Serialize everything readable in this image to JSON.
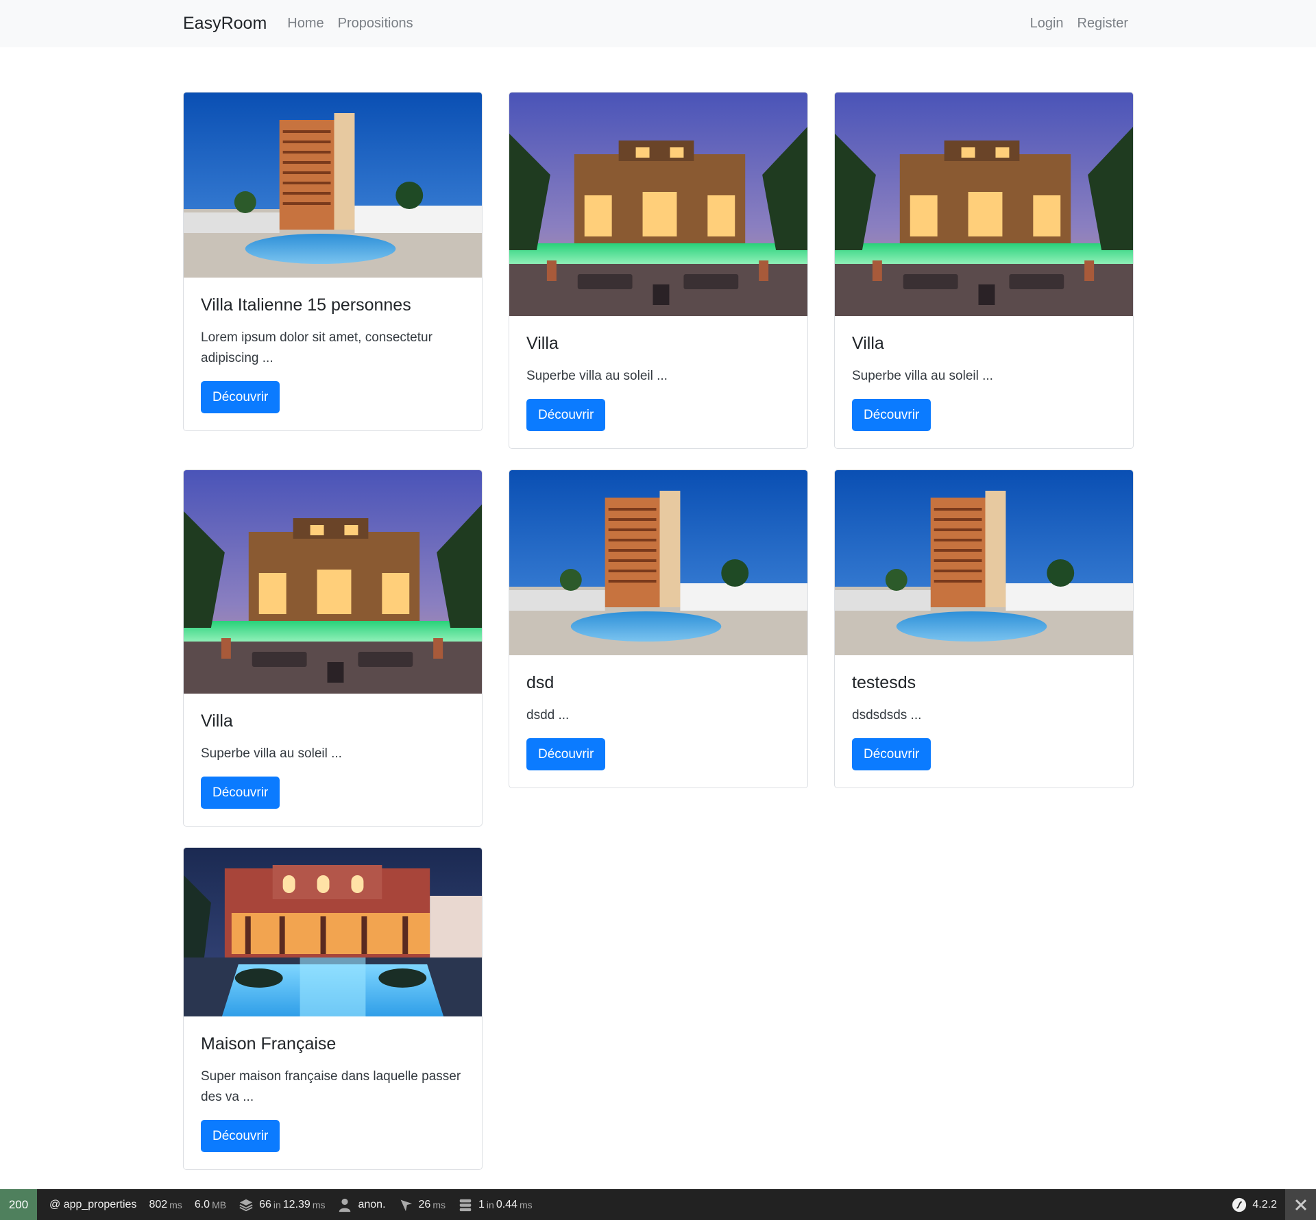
{
  "navbar": {
    "brand": "EasyRoom",
    "links": [
      "Home",
      "Propositions"
    ],
    "right_links": [
      "Login",
      "Register"
    ]
  },
  "cards": [
    {
      "title": "Villa Italienne 15 personnes",
      "text": "Lorem ipsum dolor sit amet, consectetur adipiscing ...",
      "button": "Découvrir",
      "image": "hotel-tower-pool"
    },
    {
      "title": "Villa",
      "text": "Superbe villa au soleil ...",
      "button": "Découvrir",
      "image": "villa-night-pool"
    },
    {
      "title": "Villa",
      "text": "Superbe villa au soleil ...",
      "button": "Découvrir",
      "image": "villa-night-pool"
    },
    {
      "title": "Villa",
      "text": "Superbe villa au soleil ...",
      "button": "Découvrir",
      "image": "villa-night-pool"
    },
    {
      "title": "dsd",
      "text": "dsdd ...",
      "button": "Découvrir",
      "image": "hotel-tower-pool"
    },
    {
      "title": "testesds",
      "text": "dsdsdsds ...",
      "button": "Découvrir",
      "image": "hotel-tower-pool"
    },
    {
      "title": "Maison Française",
      "text": "Super maison française dans laquelle passer des va ...",
      "button": "Découvrir",
      "image": "riad-blue-pool"
    }
  ],
  "toolbar": {
    "status": "200",
    "route": "@ app_properties",
    "time_value": "802",
    "time_unit": "ms",
    "memory_value": "6.0",
    "memory_unit": "MB",
    "twig_count": "66",
    "twig_in": "in",
    "twig_time": "12.39",
    "twig_unit": "ms",
    "user": "anon.",
    "ajax_value": "26",
    "ajax_unit": "ms",
    "db_count": "1",
    "db_in": "in",
    "db_time": "0.44",
    "db_unit": "ms",
    "version": "4.2.2"
  }
}
